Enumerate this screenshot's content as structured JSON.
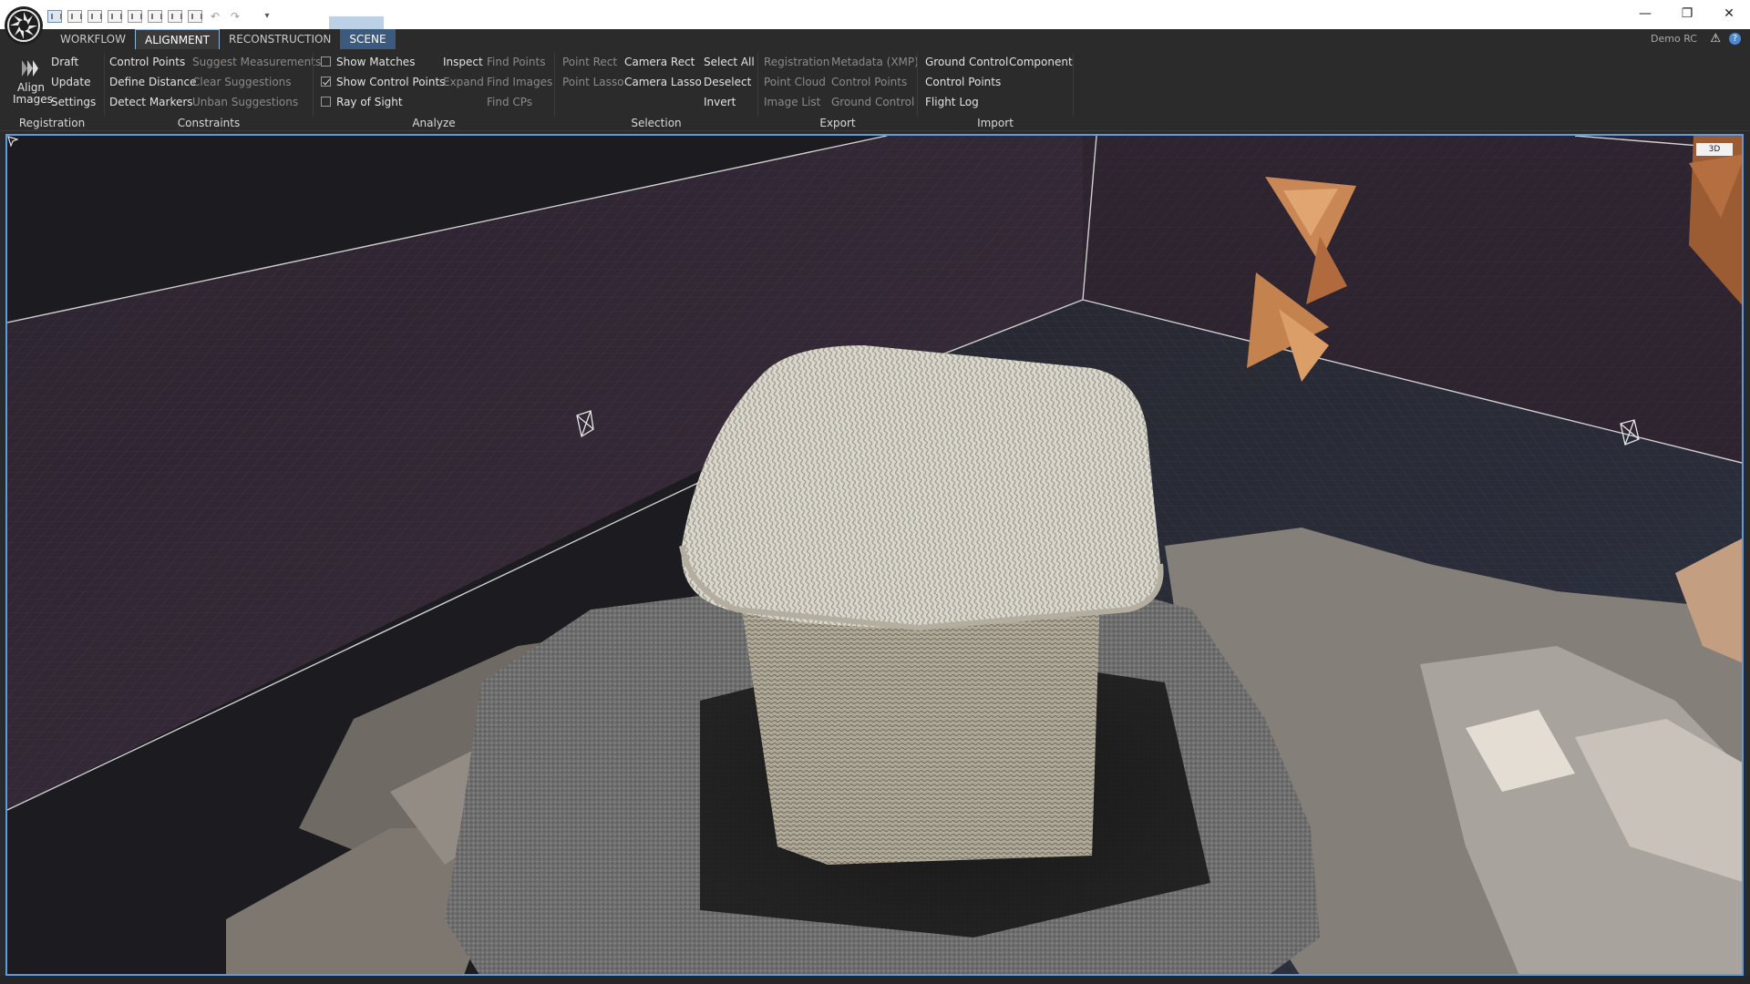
{
  "titlebar": {
    "window_controls": [
      "—",
      "❐",
      "✕"
    ]
  },
  "tabs": [
    {
      "label": "WORKFLOW"
    },
    {
      "label": "ALIGNMENT"
    },
    {
      "label": "RECONSTRUCTION"
    },
    {
      "label": "SCENE"
    }
  ],
  "account": "Demo RC",
  "help_glyph": "?",
  "warn_glyph": "⚠",
  "registration": {
    "label": "Registration",
    "align_label": "Align Images",
    "items": [
      "Draft",
      "Update",
      "Settings"
    ]
  },
  "constraints": {
    "label": "Constraints",
    "col1": [
      "Control Points",
      "Define Distance",
      "Detect Markers"
    ],
    "col2": [
      "Suggest Measurements",
      "Clear Suggestions",
      "Unban Suggestions"
    ]
  },
  "analyze": {
    "label": "Analyze",
    "checks": [
      {
        "label": "Show Matches",
        "checked": false
      },
      {
        "label": "Show Control Points",
        "checked": true
      },
      {
        "label": "Ray of Sight",
        "checked": false
      }
    ],
    "col2": [
      "Inspect",
      "Expand"
    ],
    "col3": [
      "Find Points",
      "Find Images",
      "Find CPs"
    ]
  },
  "selection": {
    "label": "Selection",
    "col1": [
      "Point Rect",
      "Point Lasso"
    ],
    "col2": [
      "Camera Rect",
      "Camera Lasso"
    ],
    "col3": [
      "Select All",
      "Deselect",
      "Invert"
    ]
  },
  "export": {
    "label": "Export",
    "col1": [
      "Registration",
      "Point Cloud",
      "Image List"
    ],
    "col2": [
      "Metadata (XMP)",
      "Control Points",
      "Ground Control"
    ]
  },
  "import": {
    "label": "Import",
    "col1": [
      "Ground Control",
      "Control Points",
      "Flight Log"
    ],
    "col2": [
      "Component"
    ]
  },
  "viewport": {
    "badge": "3D",
    "accent": "#5e9ae0"
  }
}
